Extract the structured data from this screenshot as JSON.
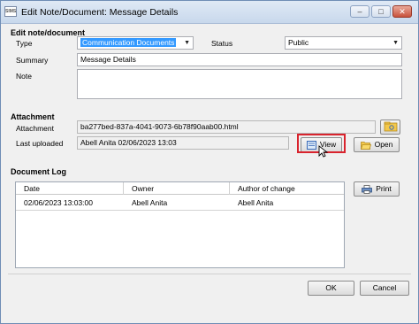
{
  "window": {
    "title": "Edit Note/Document: Message Details",
    "app_icon_text": "SIMS",
    "minimize": "–",
    "maximize": "□",
    "close": "✕"
  },
  "edit_section": {
    "title": "Edit note/document",
    "type_label": "Type",
    "type_value": "Communication Documents",
    "status_label": "Status",
    "status_value": "Public",
    "summary_label": "Summary",
    "summary_value": "Message Details",
    "note_label": "Note",
    "note_value": ""
  },
  "attachment": {
    "title": "Attachment",
    "attachment_label": "Attachment",
    "attachment_value": "ba277bed-837a-4041-9073-6b78f90aab00.html",
    "last_uploaded_label": "Last uploaded",
    "last_uploaded_value": "Abell Anita 02/06/2023 13:03",
    "view_label": "View",
    "open_label": "Open"
  },
  "document_log": {
    "title": "Document Log",
    "columns": [
      "Date",
      "Owner",
      "Author of change"
    ],
    "rows": [
      [
        "02/06/2023 13:03:00",
        "Abell Anita",
        "Abell Anita"
      ]
    ],
    "print_label": "Print"
  },
  "footer": {
    "ok_label": "OK",
    "cancel_label": "Cancel"
  },
  "colors": {
    "highlight_box": "#d9232d",
    "selection": "#3399ff"
  },
  "icons": {
    "browse": "folder-browse-icon",
    "view": "document-view-icon",
    "open": "open-folder-icon",
    "print": "printer-icon"
  }
}
